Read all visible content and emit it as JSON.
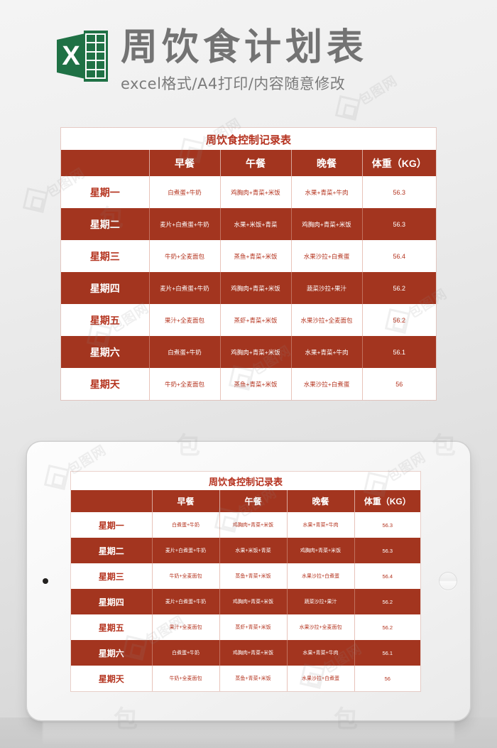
{
  "banner": {
    "logo_icon": "excel-logo-icon",
    "title": "周饮食计划表",
    "subtitle": "excel格式/A4打印/内容随意修改"
  },
  "table": {
    "title": "周饮食控制记录表",
    "columns": [
      "",
      "早餐",
      "午餐",
      "晚餐",
      "体重（KG）"
    ],
    "rows": [
      {
        "day": "星期一",
        "breakfast": "白煮蛋+牛奶",
        "lunch": "鸡胸肉+青菜+米饭",
        "dinner": "水果+青菜+牛肉",
        "weight": "56.3"
      },
      {
        "day": "星期二",
        "breakfast": "麦片+白煮蛋+牛奶",
        "lunch": "水果+米饭+青菜",
        "dinner": "鸡胸肉+青菜+米饭",
        "weight": "56.3"
      },
      {
        "day": "星期三",
        "breakfast": "牛奶+全麦面包",
        "lunch": "蒸鱼+青菜+米饭",
        "dinner": "水果沙拉+白煮蛋",
        "weight": "56.4"
      },
      {
        "day": "星期四",
        "breakfast": "麦片+白煮蛋+牛奶",
        "lunch": "鸡胸肉+青菜+米饭",
        "dinner": "蔬菜沙拉+果汁",
        "weight": "56.2"
      },
      {
        "day": "星期五",
        "breakfast": "果汁+全麦面包",
        "lunch": "蒸虾+青菜+米饭",
        "dinner": "水果沙拉+全麦面包",
        "weight": "56.2"
      },
      {
        "day": "星期六",
        "breakfast": "白煮蛋+牛奶",
        "lunch": "鸡胸肉+青菜+米饭",
        "dinner": "水果+青菜+牛肉",
        "weight": "56.1"
      },
      {
        "day": "星期天",
        "breakfast": "牛奶+全麦面包",
        "lunch": "蒸鱼+青菜+米饭",
        "dinner": "水果沙拉+白煮蛋",
        "weight": "56"
      }
    ]
  },
  "tablet": {
    "camera_icon": "camera-dot-icon",
    "home_icon": "home-button-icon"
  },
  "watermark": {
    "text": "包图网",
    "mini_text": "包"
  },
  "colors": {
    "accent_red": "#a3351f",
    "title_red": "#b5321f",
    "excel_green": "#1f7145",
    "banner_gray": "#737373"
  }
}
